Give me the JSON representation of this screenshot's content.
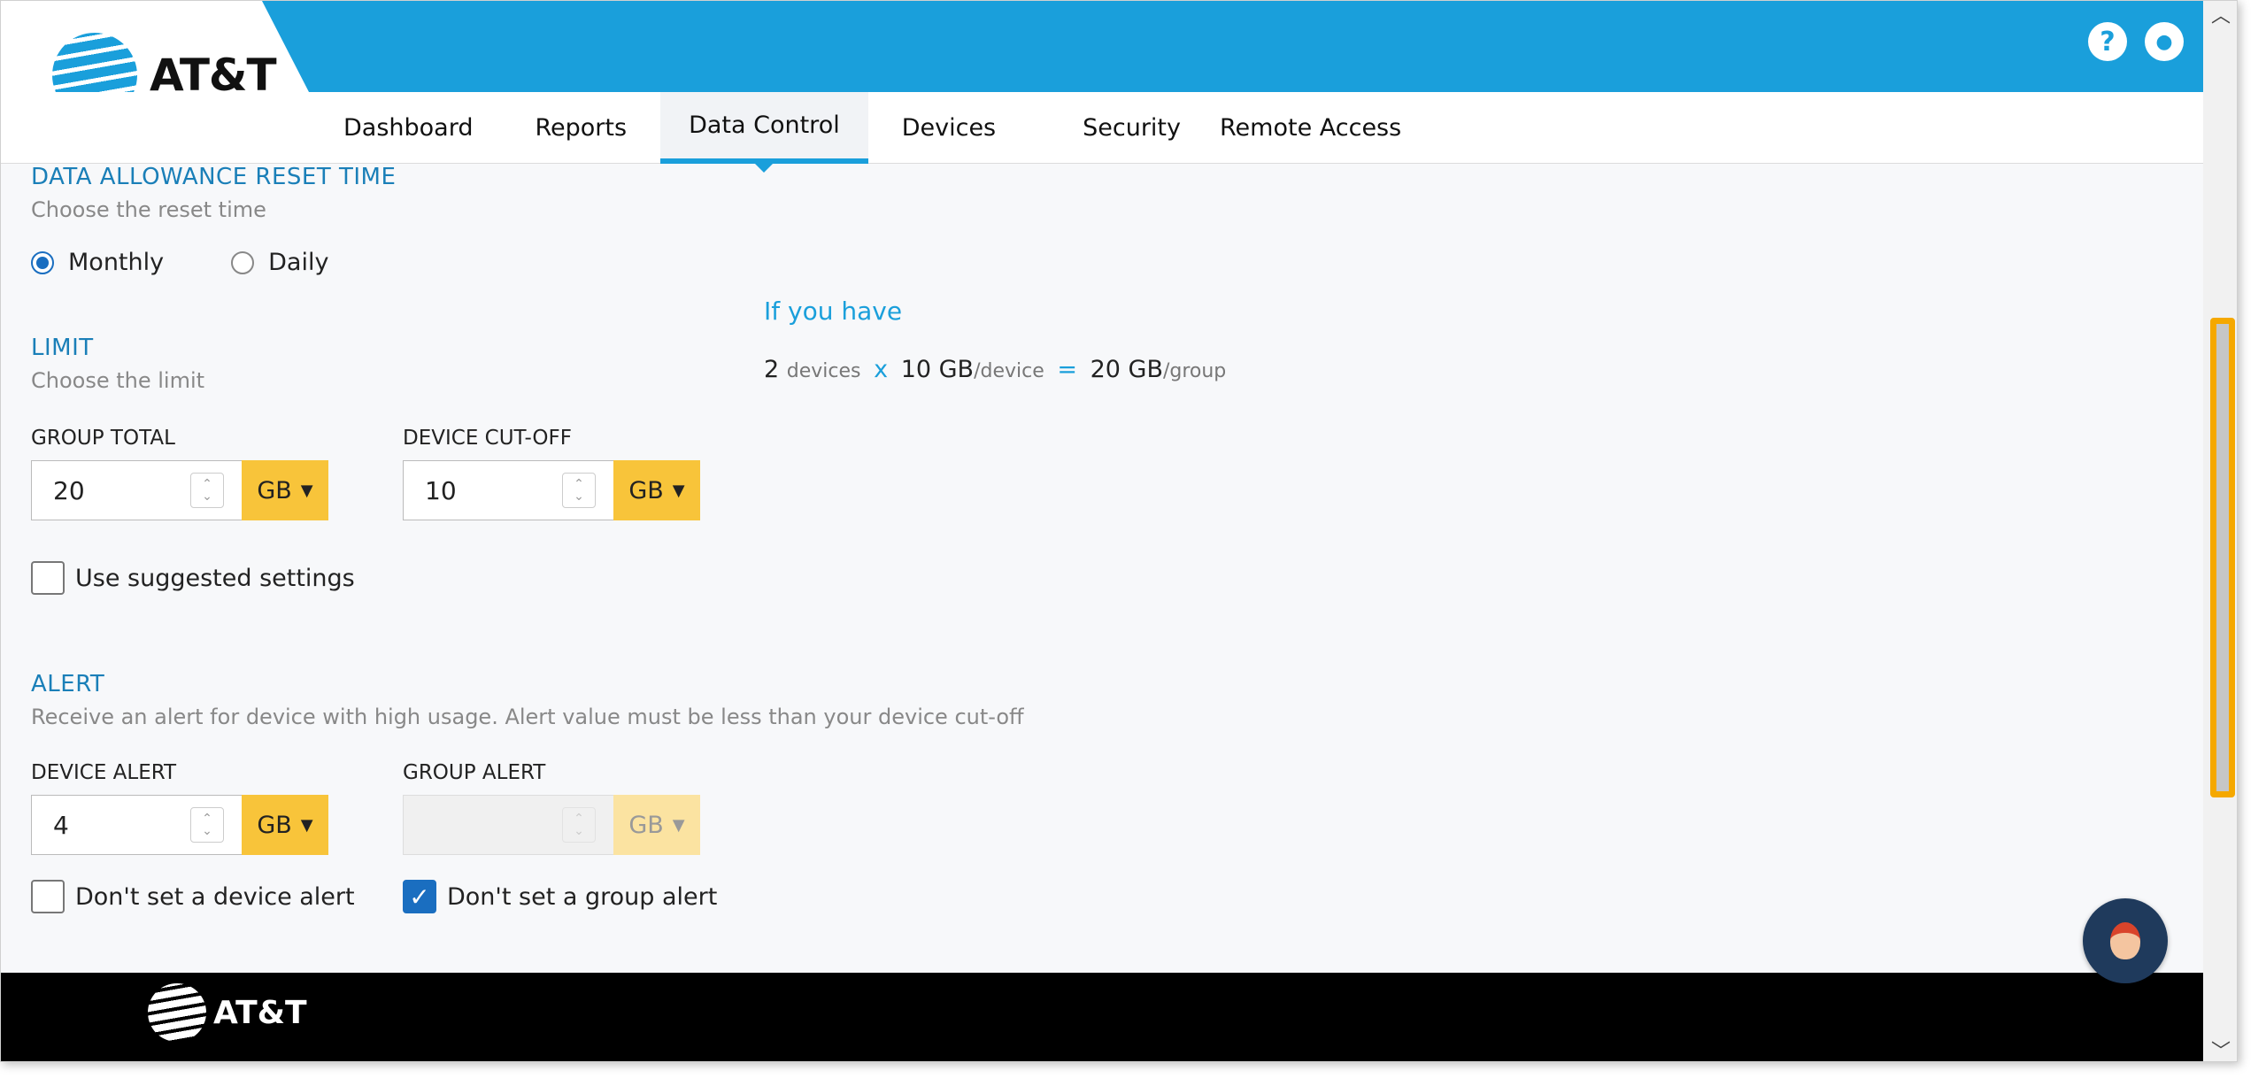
{
  "brand": {
    "name": "AT&T"
  },
  "header": {
    "icons": [
      "help-icon",
      "account-icon"
    ],
    "help_glyph": "?",
    "account_glyph": "●"
  },
  "nav": {
    "tabs": [
      {
        "label": "Dashboard"
      },
      {
        "label": "Reports"
      },
      {
        "label": "Data Control",
        "active": true
      },
      {
        "label": "Devices"
      },
      {
        "label": "Security"
      },
      {
        "label": "Remote Access"
      }
    ]
  },
  "reset": {
    "title": "DATA ALLOWANCE RESET TIME",
    "subtitle": "Choose the reset time",
    "options": [
      {
        "label": "Monthly",
        "selected": true
      },
      {
        "label": "Daily",
        "selected": false
      }
    ]
  },
  "limit": {
    "title": "LIMIT",
    "subtitle": "Choose the limit",
    "group_total": {
      "label": "GROUP TOTAL",
      "value": "20",
      "unit": "GB"
    },
    "device_cutoff": {
      "label": "DEVICE CUT-OFF",
      "value": "10",
      "unit": "GB"
    },
    "suggested_label": "Use suggested settings",
    "if_you_have": {
      "title": "If you have",
      "devices": "2",
      "devices_unit": "devices",
      "times": "x",
      "per_device": "10 GB",
      "per_device_unit": "/device",
      "equals": "=",
      "group_value": "20 GB",
      "group_unit": "/group"
    }
  },
  "alert": {
    "title": "ALERT",
    "subtitle": "Receive an alert for device with high usage. Alert value must be less than your device cut-off",
    "device_alert": {
      "label": "DEVICE ALERT",
      "value": "4",
      "unit": "GB"
    },
    "group_alert": {
      "label": "GROUP ALERT",
      "value": "",
      "unit": "GB",
      "disabled": true
    },
    "no_device_alert_label": "Don't set a device alert",
    "no_device_alert_checked": false,
    "no_group_alert_label": "Don't set a group alert",
    "no_group_alert_checked": true
  },
  "colors": {
    "accent": "#1a9fdb",
    "unit_button": "#f8c43a",
    "scroll_highlight": "#f5a800"
  }
}
